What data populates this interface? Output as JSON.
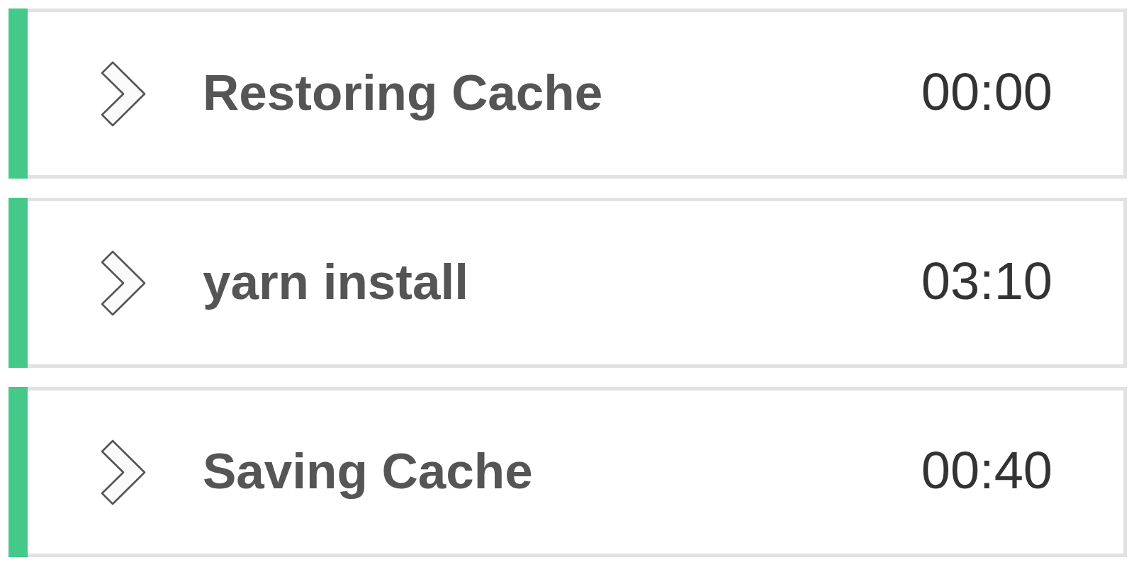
{
  "steps": [
    {
      "name": "Restoring Cache",
      "duration": "00:00",
      "color": "#45c98a",
      "expanded": false
    },
    {
      "name": "yarn install",
      "duration": "03:10",
      "color": "#45c98a",
      "expanded": false
    },
    {
      "name": "Saving Cache",
      "duration": "00:40",
      "color": "#45c98a",
      "expanded": false
    }
  ]
}
